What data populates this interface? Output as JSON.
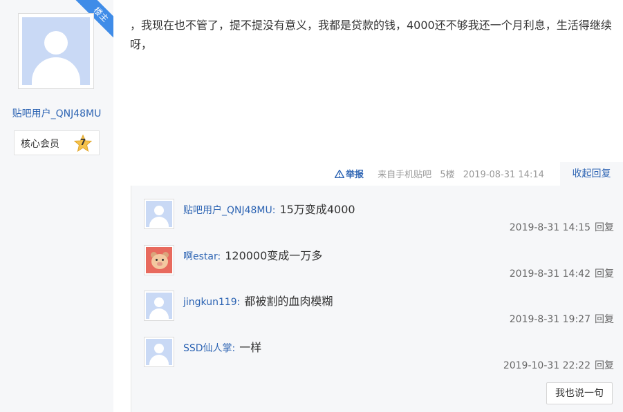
{
  "author": {
    "badge_label": "楼主",
    "name": "贴吧用户_QNJ48MU",
    "member_label": "核心会员",
    "level": "7"
  },
  "post": {
    "content": "，我现在也不管了，提不提没有意义，我都是贷款的钱，4000还不够我还一个月利息，生活得继续呀，",
    "report_label": "举报",
    "source": "来自手机贴吧",
    "floor": "5楼",
    "datetime": "2019-08-31 14:14",
    "collapse_label": "收起回复"
  },
  "replies": [
    {
      "user": "贴吧用户_QNJ48MU:",
      "content": "15万变成4000",
      "time": "2019-8-31 14:15",
      "reply_label": "回复",
      "avatar": "default-avatar"
    },
    {
      "user": "啊estar:",
      "content": "120000变成一万多",
      "time": "2019-8-31 14:42",
      "reply_label": "回复",
      "avatar": "pig-avatar"
    },
    {
      "user": "jingkun119:",
      "content": "都被割的血肉模糊",
      "time": "2019-8-31 19:27",
      "reply_label": "回复",
      "avatar": "default-avatar"
    },
    {
      "user": "SSD仙人掌:",
      "content": "一样",
      "time": "2019-10-31 22:22",
      "reply_label": "回复",
      "avatar": "default-avatar"
    }
  ],
  "say_button_label": "我也说一句",
  "colors": {
    "link": "#2d64b3",
    "ribbon": "#3f8ce8",
    "panel": "#f6f7f9",
    "avatar_bg": "#c9d9f5"
  }
}
